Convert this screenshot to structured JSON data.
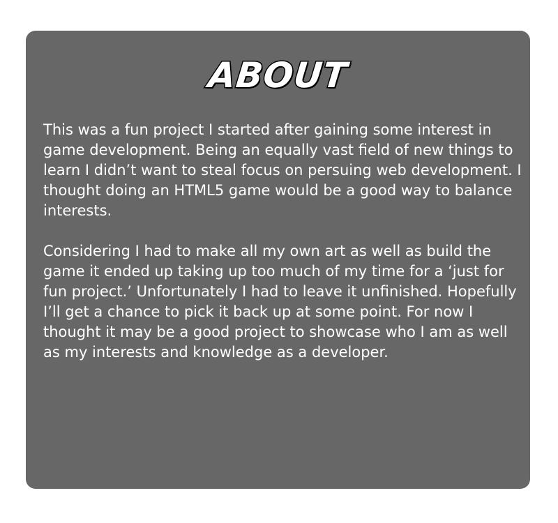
{
  "about": {
    "heading": "ABOUT",
    "paragraphs": [
      "This was a fun project I started after gaining some interest in game development. Being an equally vast field of new things to learn I didn’t want to steal focus on persuing web development. I thought doing an HTML5 game would be a good way to balance interests.",
      "Considering I had to make all my own art as well as build the game it ended up taking up too much of my time for a ‘just for fun project.’ Unfortunately I had to leave it unfinished. Hopefully I’ll get a chance to pick it back up at some point. For now I thought it may be a good project to showcase who I am as well as my interests and knowledge as a developer."
    ]
  },
  "colors": {
    "panel_background": "#676767",
    "text": "#ffffff",
    "heading_outline": "#000000"
  }
}
